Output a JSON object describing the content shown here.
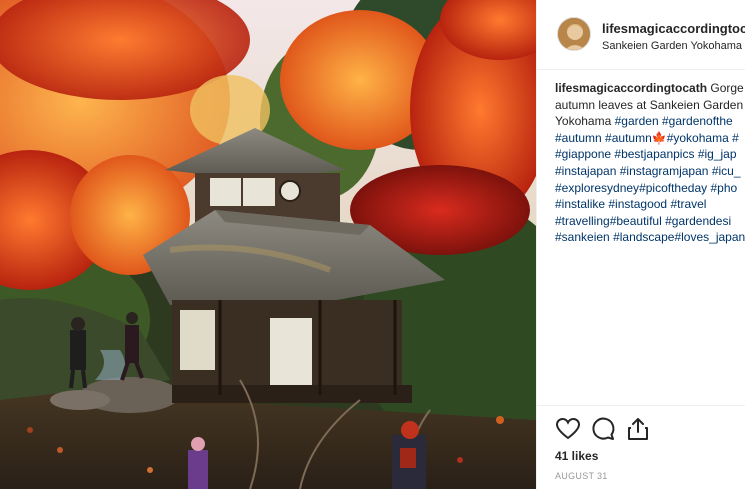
{
  "post": {
    "photo_alt": "Sankeien Garden pavilion",
    "username": "lifesmagicaccordingtocath",
    "location": "Sankeien Garden Yokohama",
    "caption": {
      "author": "lifesmagicaccordingtocath",
      "line1_text": " Gorge",
      "line2_text": "autumn leaves at Sankeien Garden",
      "line3_text": "Yokohama ",
      "line3_tags": [
        "#garden",
        "#gardenofthe"
      ],
      "line4_tags": [
        "#autumn",
        "#autumn"
      ],
      "line4_emoji": "🍁",
      "line4_tail": "#yokohama #",
      "line5_tags": [
        "#giappone",
        "#bestjapanpics",
        "#ig_jap"
      ],
      "line6_tags": [
        "#instajapan",
        "#instagramjapan",
        "#icu_"
      ],
      "line7_tags": [
        "#exploresydney",
        "#picoftheday",
        "#pho"
      ],
      "line8_tags": [
        "#instalike",
        "#instagood",
        "#travel"
      ],
      "line9_tags": [
        "#travelling",
        "#beautiful",
        "#gardendesi"
      ],
      "line10_tags": [
        "#sankeien",
        "#landscape",
        "#loves_japan"
      ]
    },
    "icons": [
      "heart-icon",
      "comment-icon",
      "share-icon"
    ],
    "likes": "41 likes",
    "date": "AUGUST 31"
  },
  "colors": {
    "tag": "#003569",
    "text": "#262626",
    "muted": "#999999",
    "border": "#efefef"
  }
}
